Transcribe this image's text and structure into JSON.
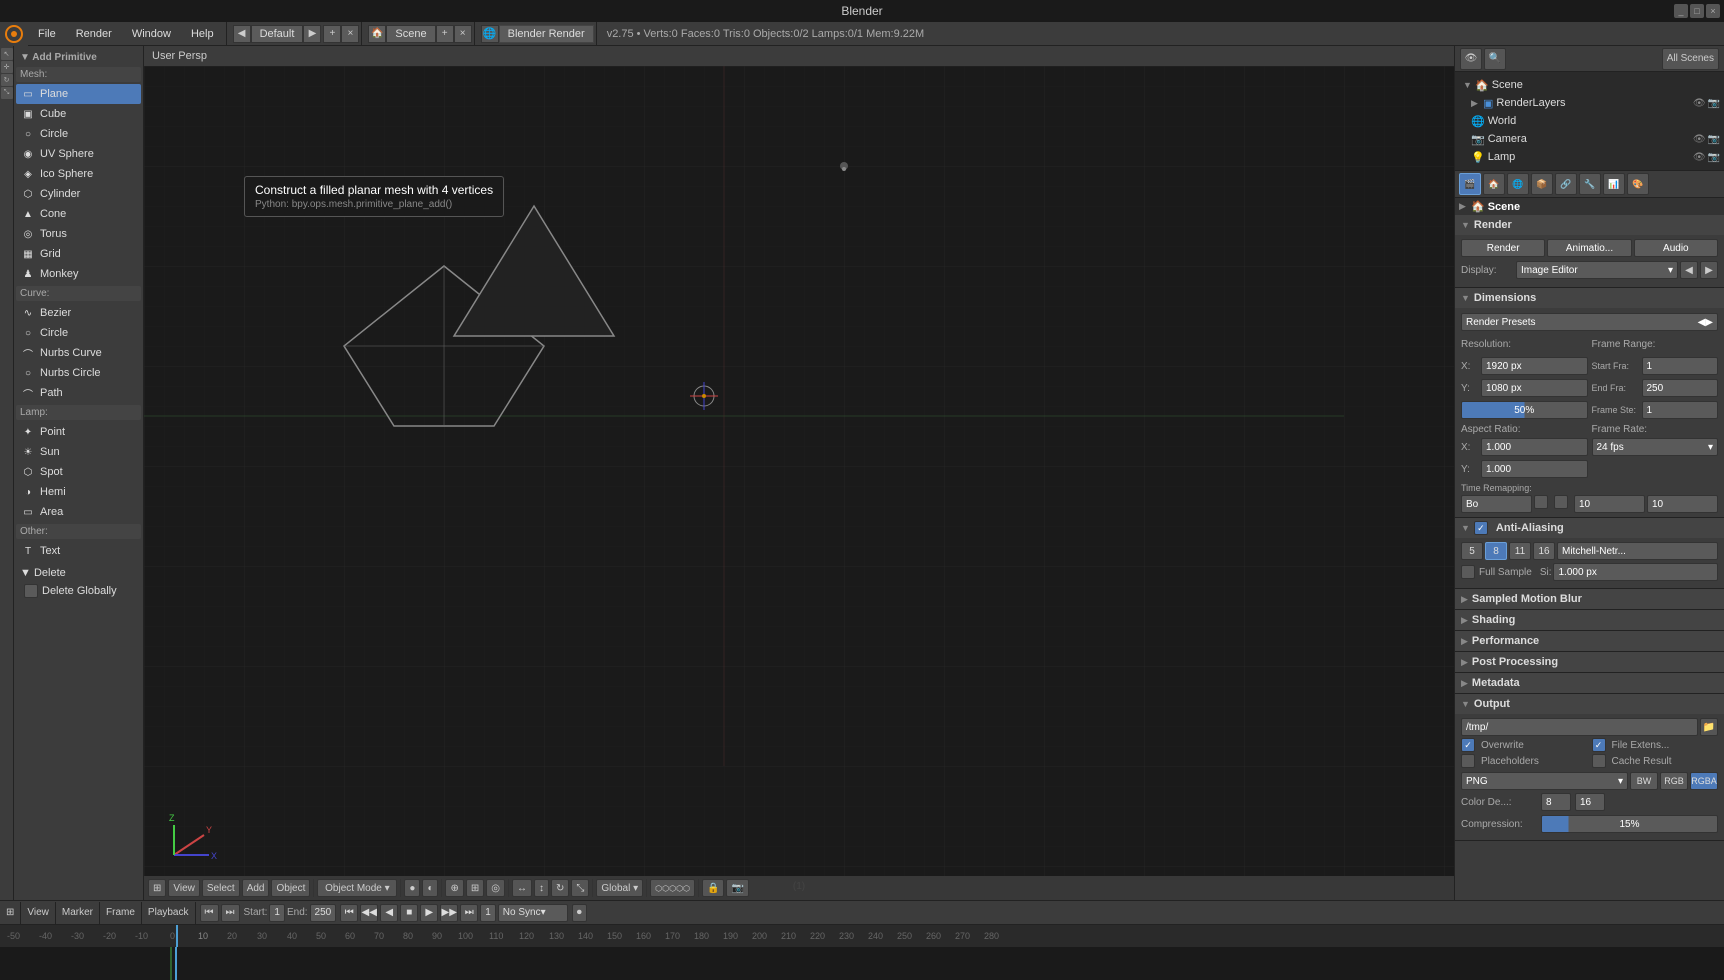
{
  "titlebar": {
    "title": "Blender"
  },
  "menubar": {
    "logo": "●",
    "items": [
      "File",
      "Render",
      "Window",
      "Help"
    ],
    "workspace": {
      "minus": "◀",
      "label": "Default",
      "plus": "▶"
    },
    "scene": {
      "label": "Scene"
    },
    "render_engine": {
      "label": "Blender Render"
    },
    "info": "v2.75 • Verts:0  Faces:0  Tris:0  Objects:0/2  Lamps:0/1  Mem:9.22M"
  },
  "left_panel": {
    "header": "▼ Add Primitive",
    "sections": {
      "mesh": {
        "title": "Mesh:",
        "items": [
          {
            "label": "Plane",
            "icon": "▭"
          },
          {
            "label": "Cube",
            "icon": "▣"
          },
          {
            "label": "Circle",
            "icon": "○"
          },
          {
            "label": "UV Sphere",
            "icon": "◉"
          },
          {
            "label": "Ico Sphere",
            "icon": "◈"
          },
          {
            "label": "Cylinder",
            "icon": "⬡"
          },
          {
            "label": "Cone",
            "icon": "▲"
          },
          {
            "label": "Torus",
            "icon": "◎"
          },
          {
            "label": "Grid",
            "icon": "▦"
          },
          {
            "label": "Monkey",
            "icon": "♟"
          }
        ]
      },
      "curve": {
        "title": "Curve:",
        "items": [
          {
            "label": "Bezier",
            "icon": "∿"
          },
          {
            "label": "Circle",
            "icon": "○"
          },
          {
            "label": "Nurbs Curve",
            "icon": "⌒"
          },
          {
            "label": "Nurbs Circle",
            "icon": "○"
          },
          {
            "label": "Path",
            "icon": "⌒"
          }
        ]
      },
      "lamp": {
        "title": "Lamp:",
        "items": [
          {
            "label": "Point",
            "icon": "✦"
          },
          {
            "label": "Sun",
            "icon": "☀"
          },
          {
            "label": "Spot",
            "icon": "⬡"
          },
          {
            "label": "Hemi",
            "icon": "◑"
          },
          {
            "label": "Area",
            "icon": "▭"
          }
        ]
      },
      "other": {
        "title": "Other:",
        "items": [
          {
            "label": "Text",
            "icon": "T"
          }
        ]
      }
    },
    "delete": {
      "header": "▼ Delete",
      "items": [
        "Delete Globally"
      ]
    }
  },
  "tooltip": {
    "title": "Construct a filled planar mesh with 4 vertices",
    "python": "Python: bpy.ops.mesh.primitive_plane_add()"
  },
  "viewport": {
    "header": "User Persp",
    "frame": "(1)"
  },
  "right_panel": {
    "tabs": [
      "R",
      "C",
      "W",
      "O",
      "P",
      "F",
      "D",
      "M"
    ],
    "active_tab_index": 0,
    "scene": {
      "arrow": "▶",
      "label": "Scene"
    },
    "scene_tree": {
      "root": "Scene",
      "children": [
        {
          "label": "RenderLayers",
          "indent": 1
        },
        {
          "label": "World",
          "indent": 1
        },
        {
          "label": "Camera",
          "indent": 1
        },
        {
          "label": "Lamp",
          "indent": 1
        }
      ]
    },
    "render_section": {
      "title": "Render",
      "buttons": [
        "Render",
        "Animatio...",
        "Audio"
      ]
    },
    "display": {
      "label": "Display:",
      "value": "Image Editor"
    },
    "dimensions": {
      "title": "Dimensions",
      "render_presets": "Render Presets",
      "resolution_label": "Resolution:",
      "x_label": "X:",
      "x_value": "1920 px",
      "y_label": "Y:",
      "y_value": "1080 px",
      "percent": "50%",
      "frame_range_label": "Frame Range:",
      "start_label": "Start Fra:",
      "start_value": "1",
      "end_label": "End Fra:",
      "end_value": "250",
      "step_label": "Frame Ste:",
      "step_value": "1",
      "aspect_label": "Aspect Ratio:",
      "aspect_x": "1.000",
      "aspect_y": "1.000",
      "frame_rate_label": "Frame Rate:",
      "fps": "24 fps",
      "time_remapping_label": "Time Remapping:",
      "old": "10",
      "new": "10",
      "bo_label": "Bo"
    },
    "anti_aliasing": {
      "title": "Anti-Aliasing",
      "enabled": true,
      "samples": [
        "5",
        "8",
        "11",
        "16"
      ],
      "active_sample": "8",
      "filter": "Mitchell-Netr...",
      "full_sample_label": "Full Sample",
      "si_label": "Si:",
      "si_value": "1.000 px"
    },
    "sampled_motion_blur": {
      "title": "Sampled Motion Blur"
    },
    "shading": {
      "title": "Shading"
    },
    "performance": {
      "title": "Performance"
    },
    "post_processing": {
      "title": "Post Processing"
    },
    "metadata": {
      "title": "Metadata"
    },
    "output": {
      "title": "Output",
      "path": "/tmp/",
      "overwrite_label": "Overwrite",
      "overwrite_checked": true,
      "file_extensions_label": "File Extens...",
      "file_extensions_checked": true,
      "placeholders_label": "Placeholders",
      "placeholders_checked": false,
      "cache_result_label": "Cache Result",
      "cache_result_checked": false,
      "format": "PNG",
      "color_mode_bw": "BW",
      "color_mode_rgb": "RGB",
      "color_mode_rgba_active": "RGBA",
      "color_depth_label": "Color De...:",
      "color_depth_value": "8",
      "compression_label": "Compression:",
      "compression_value": "15%"
    }
  },
  "bottom_bar": {
    "viewport_controls": {
      "mode": "Object Mode",
      "buttons": [
        "View",
        "Select",
        "Add",
        "Object"
      ]
    },
    "timeline": {
      "start_label": "Start:",
      "start": "1",
      "end_label": "End:",
      "end": "250",
      "current": "1",
      "sync": "No Sync",
      "ticks": [
        "-50",
        "-40",
        "-30",
        "-20",
        "-10",
        "0",
        "10",
        "20",
        "30",
        "40",
        "50",
        "60",
        "70",
        "80",
        "90",
        "100",
        "110",
        "120",
        "130",
        "140",
        "150",
        "160",
        "170",
        "180",
        "190",
        "200",
        "210",
        "220",
        "230",
        "240",
        "250",
        "260",
        "270",
        "280"
      ]
    }
  }
}
